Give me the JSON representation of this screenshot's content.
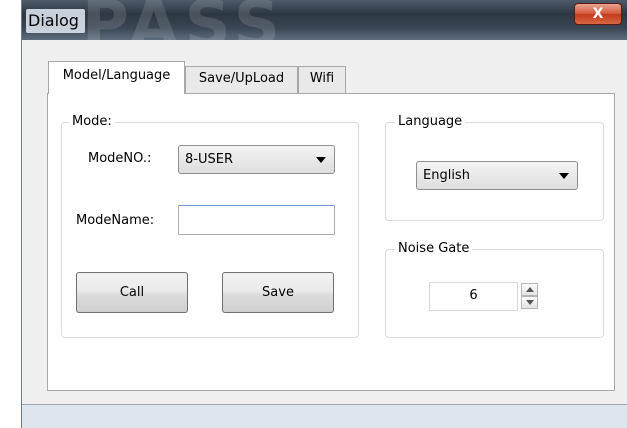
{
  "window": {
    "title": "Dialog",
    "background_text": "PASS",
    "close_label": "X"
  },
  "tabs": [
    {
      "label": "Model/Language",
      "active": true
    },
    {
      "label": "Save/UpLoad",
      "active": false
    },
    {
      "label": "Wifi",
      "active": false
    }
  ],
  "mode_group": {
    "legend": "Mode:",
    "modeno_label": "ModeNO.:",
    "modeno_value": "8-USER",
    "modename_label": "ModeName:",
    "modename_value": "",
    "call_button": "Call",
    "save_button": "Save"
  },
  "language_group": {
    "legend": "Language",
    "selected": "English"
  },
  "noise_gate_group": {
    "legend": "Noise Gate",
    "value": "6"
  },
  "colors": {
    "close_button": "#c23a1b",
    "title_bar": "#2c3743",
    "dialog_face": "#f0f0f0"
  }
}
